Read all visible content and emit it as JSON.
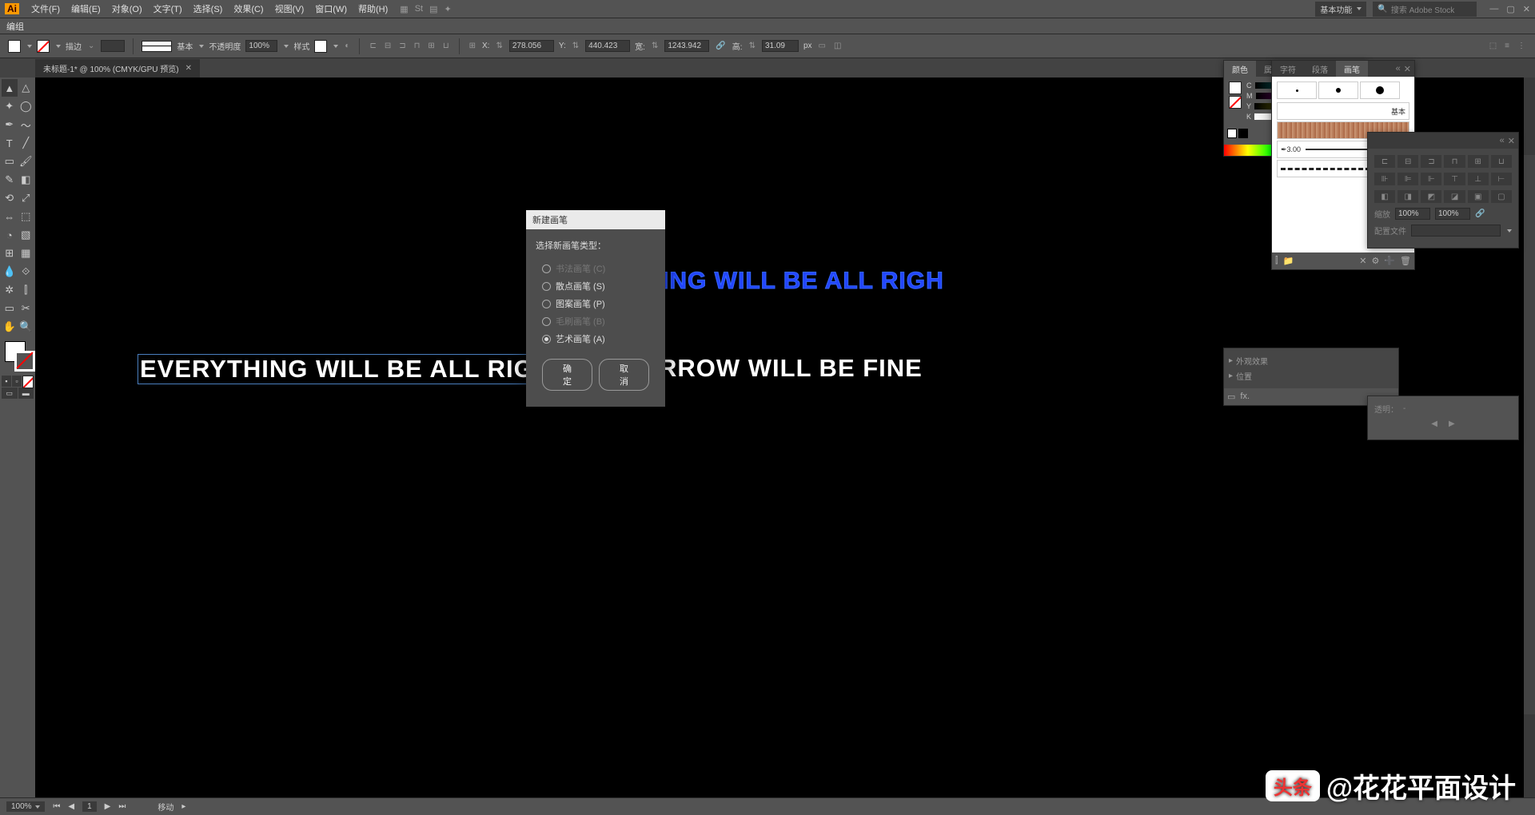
{
  "menubar": {
    "logo": "Ai",
    "items": [
      "文件(F)",
      "编辑(E)",
      "对象(O)",
      "文字(T)",
      "选择(S)",
      "效果(C)",
      "视图(V)",
      "窗口(W)",
      "帮助(H)"
    ],
    "workspace": "基本功能",
    "search_placeholder": "搜索 Adobe Stock"
  },
  "mode": {
    "label": "编组"
  },
  "controlbar": {
    "stroke_label": "描边",
    "stroke_pt": "",
    "profile_label": "基本",
    "opacity_label": "不透明度",
    "opacity_val": "100%",
    "style_label": "样式",
    "x_label": "X:",
    "x_val": "278.056",
    "y_label": "Y:",
    "y_val": "440.423",
    "w_label": "宽:",
    "w_val": "1243.942",
    "h_label": "高:",
    "h_val": "31.09",
    "unit": "px"
  },
  "tab": {
    "title": "未标题-1* @ 100% (CMYK/GPU 预览)"
  },
  "canvas": {
    "line1": "ING WILL BE ALL RIGH",
    "line2a": "EVERYTHING WILL BE ALL RIG",
    "line2b": "RROW WILL BE FINE"
  },
  "dialog": {
    "title": "新建画笔",
    "prompt": "选择新画笔类型：",
    "opt_c": "书法画笔 (C)",
    "opt_s": "散点画笔 (S)",
    "opt_p": "图案画笔 (P)",
    "opt_b": "毛刷画笔 (B)",
    "opt_a": "艺术画笔 (A)",
    "ok": "确定",
    "cancel": "取消"
  },
  "panels": {
    "color_tab1": "颜色",
    "color_tab2": "属性",
    "char_tab": "字符",
    "para_tab": "段落",
    "brush_tab": "画笔",
    "basic_label": "基本",
    "brush_size": "3.00",
    "transparency_tab": "透明",
    "opacity_100": "100%",
    "profile_label": "配置文件",
    "layers": {
      "r1": "外观效果",
      "r2": "位置"
    },
    "transp_label": "透明："
  },
  "statusbar": {
    "zoom": "100%",
    "artboard": "1",
    "tool": "移动"
  },
  "watermark": {
    "badge": "头条",
    "text": "@花花平面设计"
  }
}
